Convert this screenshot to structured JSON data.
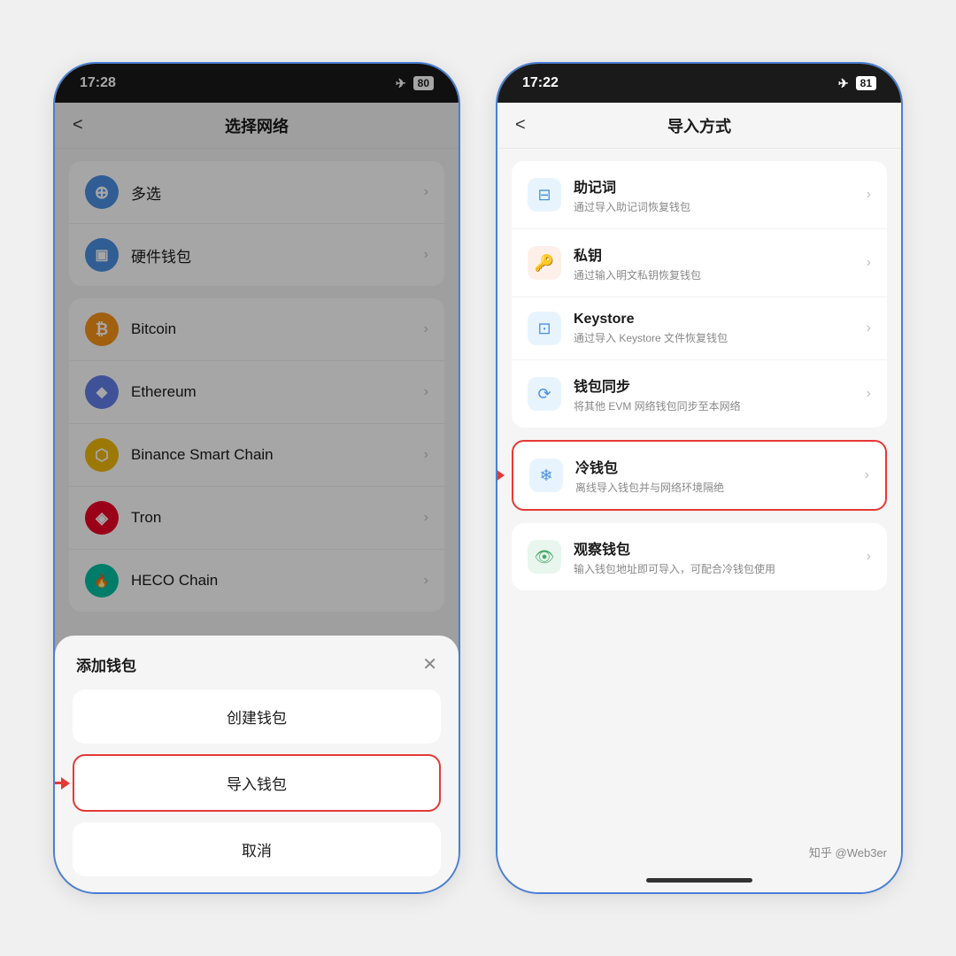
{
  "left_phone": {
    "status_bar": {
      "time": "17:28",
      "airplane": "✈",
      "battery": "80"
    },
    "nav_title": "选择网络",
    "back_label": "<",
    "networks": [
      {
        "name": "多选",
        "icon_type": "multiselect",
        "icon_char": "+"
      },
      {
        "name": "硬件钱包",
        "icon_type": "hardware",
        "icon_char": "▣"
      },
      {
        "name": "Bitcoin",
        "icon_type": "bitcoin",
        "icon_char": "₿"
      },
      {
        "name": "Ethereum",
        "icon_type": "ethereum",
        "icon_char": "◆"
      },
      {
        "name": "Binance Smart Chain",
        "icon_type": "bsc",
        "icon_char": "⬡"
      },
      {
        "name": "Tron",
        "icon_type": "tron",
        "icon_char": "◈"
      },
      {
        "name": "HECO Chain",
        "icon_type": "heco",
        "icon_char": "⬡"
      }
    ],
    "modal": {
      "title": "添加钱包",
      "create_label": "创建钱包",
      "import_label": "导入钱包",
      "cancel_label": "取消"
    },
    "home_bar": true
  },
  "right_phone": {
    "status_bar": {
      "time": "17:22",
      "airplane": "✈",
      "battery": "81"
    },
    "nav_title": "导入方式",
    "back_label": "<",
    "import_methods_group1": [
      {
        "name": "助记词",
        "desc": "通过导入助记词恢复钱包",
        "icon_type": "mnemonic"
      },
      {
        "name": "私钥",
        "desc": "通过输入明文私钥恢复钱包",
        "icon_type": "privatekey"
      },
      {
        "name": "Keystore",
        "desc": "通过导入 Keystore 文件恢复钱包",
        "icon_type": "keystore"
      },
      {
        "name": "钱包同步",
        "desc": "将其他 EVM 网络钱包同步至本网络",
        "icon_type": "walletsync"
      }
    ],
    "cold_wallet": {
      "name": "冷钱包",
      "desc": "离线导入钱包并与网络环境隔绝",
      "icon_type": "coldwallet"
    },
    "observer_wallet": {
      "name": "观察钱包",
      "desc": "输入钱包地址即可导入，可配合冷钱包使用",
      "icon_type": "observer"
    },
    "watermark": "知乎 @Web3er",
    "home_bar": true
  }
}
